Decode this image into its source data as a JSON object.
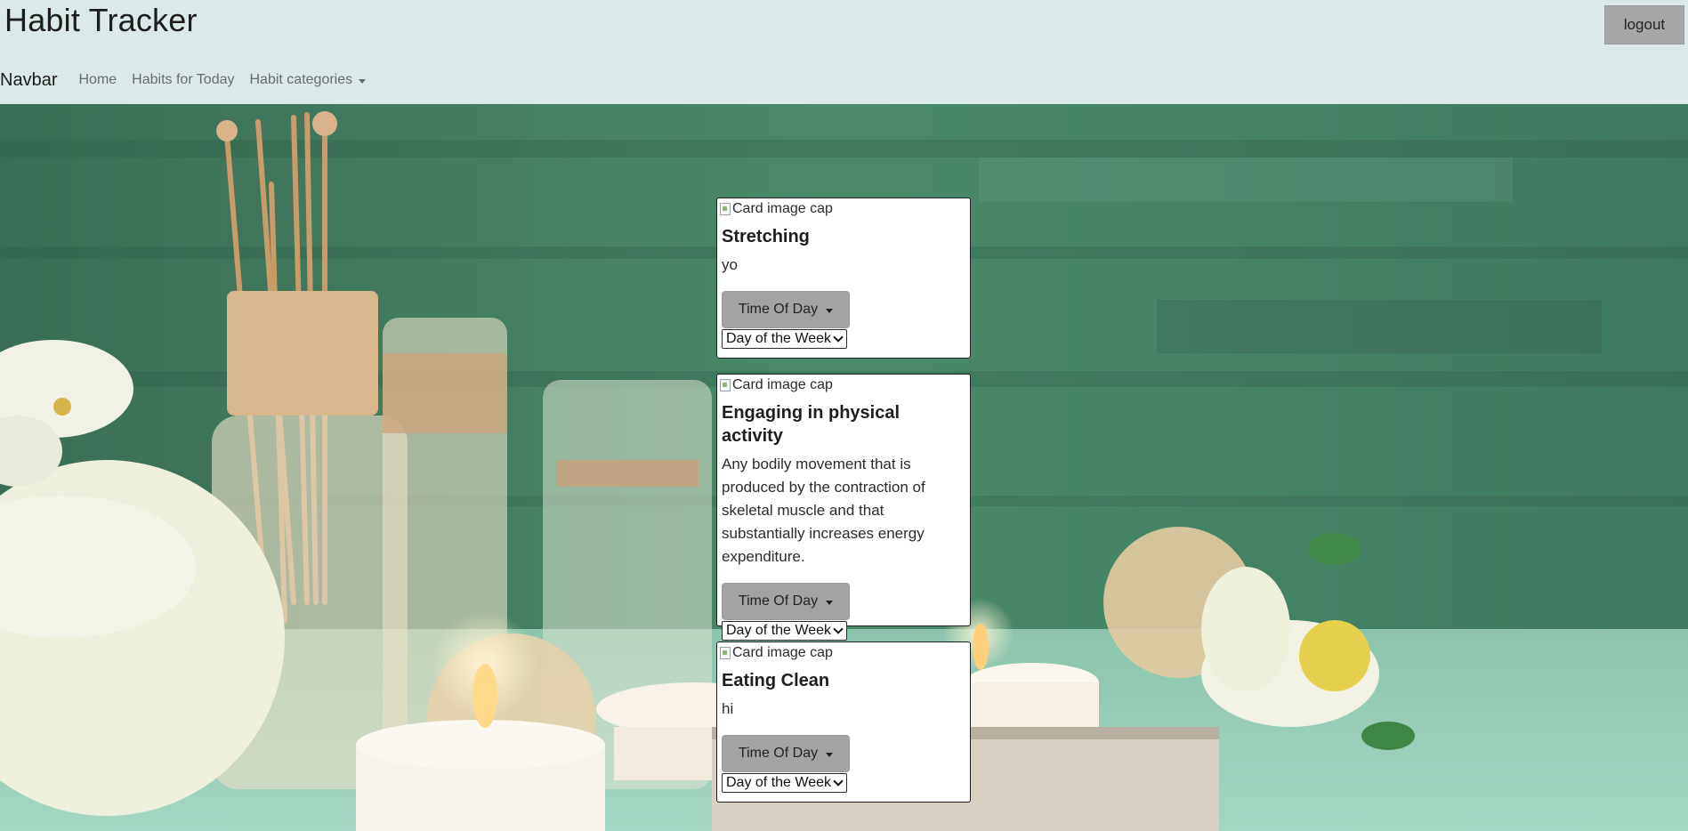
{
  "app": {
    "title": "Habit Tracker",
    "logout_label": "logout"
  },
  "navbar": {
    "brand": "Navbar",
    "links": [
      {
        "label": "Home"
      },
      {
        "label": "Habits for Today"
      },
      {
        "label": "Habit categories"
      }
    ]
  },
  "cards": [
    {
      "image_alt": "Card image cap",
      "title": "Stretching",
      "text": "yo",
      "time_button": "Time Of Day",
      "day_select": "Day of the Week"
    },
    {
      "image_alt": "Card image cap",
      "title": "Engaging in physical activity",
      "text": "Any bodily movement that is produced by the contraction of skeletal muscle and that substantially increases energy expenditure.",
      "time_button": "Time Of Day",
      "day_select": "Day of the Week"
    },
    {
      "image_alt": "Card image cap",
      "title": "Eating Clean",
      "text": "hi",
      "time_button": "Time Of Day",
      "day_select": "Day of the Week"
    }
  ],
  "colors": {
    "header_bg": "#dbe9e8",
    "button_gray": "#a3a3a3",
    "scene_green": "#3f7a5f"
  }
}
